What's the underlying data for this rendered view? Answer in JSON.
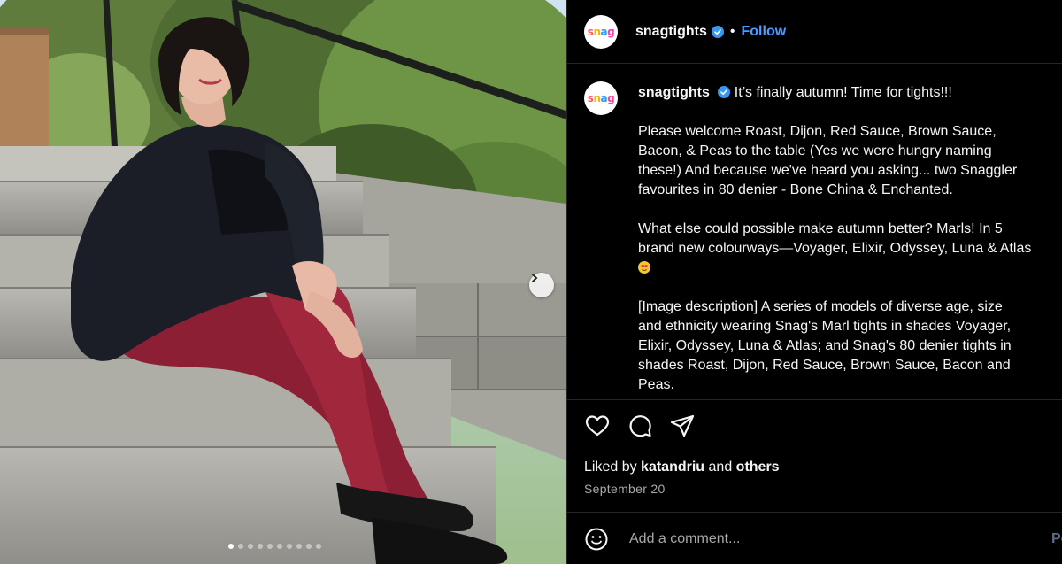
{
  "header": {
    "avatar_logo": "snag",
    "username": "snagtights",
    "separator": "•",
    "follow_label": "Follow"
  },
  "caption": {
    "username": "snagtights",
    "first_line": "It’s finally autumn! Time for tights!!!",
    "paragraph_1": [
      "Please welcome Roast, Dijon, Red Sauce, Brown Sauce,",
      "Bacon, & Peas to the table (Yes we were hungry naming",
      "these!) And because we've heard you asking... two Snaggler",
      "favourites in 80 denier - Bone China & Enchanted."
    ],
    "paragraph_2": [
      "What else could possible make autumn better? Marls! In 5",
      "brand new colourways—Voyager, Elixir, Odyssey, Luna & Atlas"
    ],
    "paragraph_3": [
      "[Image description] A series of models of diverse age, size",
      "and ethnicity wearing Snag's Marl tights in shades Voyager,",
      "Elixir, Odyssey, Luna & Atlas; and Snag's 80 denier tights in",
      "shades Roast, Dijon, Red Sauce, Brown Sauce, Bacon and",
      "Peas."
    ],
    "emoji": "heart-eyes-emoji"
  },
  "likes": {
    "prefix": "Liked by",
    "user": "katandriu",
    "connector": "and",
    "others": "others"
  },
  "date": "September 20",
  "comment": {
    "placeholder": "Add a comment...",
    "post_label": "Po"
  },
  "carousel": {
    "dot_count": 10,
    "active_index": 0
  },
  "icons": [
    "heart-icon",
    "comment-icon",
    "share-icon",
    "emoji-icon",
    "next-arrow-icon",
    "verified-badge-icon"
  ],
  "colors": {
    "background": "#000000",
    "text": "#f5f5f5",
    "accent_follow": "#4a9eff",
    "verified": "#3897f0",
    "muted": "#a8a8a8",
    "divider": "#262626"
  }
}
